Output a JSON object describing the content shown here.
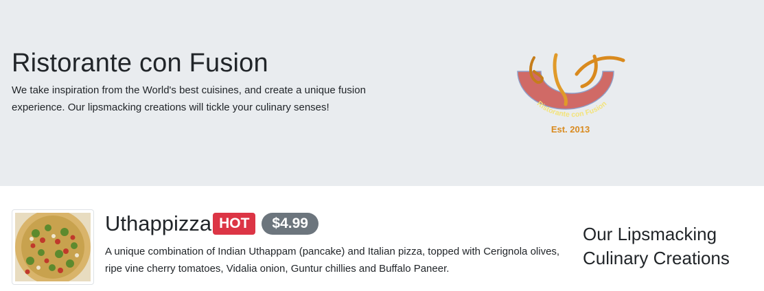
{
  "jumbotron": {
    "title": "Ristorante con Fusion",
    "description": "We take inspiration from the World's best cuisines, and create a unique fusion experience. Our lipsmacking creations will tickle your culinary senses!",
    "logo": {
      "arc_text": "Ristorante con Fusion",
      "est_text": "Est. 2013",
      "colors": {
        "arc": "#d06a66",
        "accent": "#d98a1e",
        "text": "#f3e37a"
      }
    }
  },
  "dish": {
    "name": "Uthappizza",
    "label": "HOT",
    "price": "$4.99",
    "description": "A unique combination of Indian Uthappam (pancake) and Italian pizza, topped with Cerignola olives, ripe vine cherry tomatoes, Vidalia onion, Guntur chillies and Buffalo Paneer."
  },
  "side": {
    "title": "Our Lipsmacking Culinary Creations"
  },
  "colors": {
    "jumbotron_bg": "#e9ecef",
    "badge_hot": "#dc3545",
    "badge_price": "#6c757d"
  }
}
